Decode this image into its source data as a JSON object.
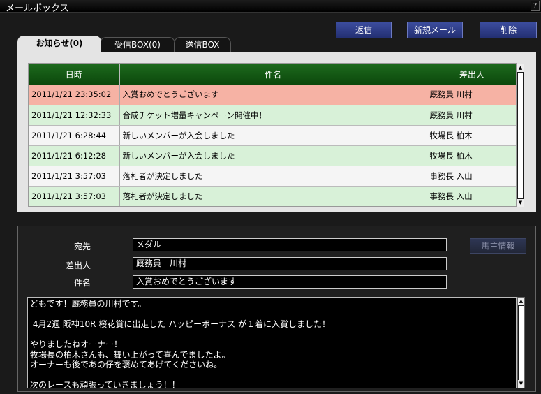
{
  "window": {
    "title": "メールボックス",
    "help": "?"
  },
  "toolbar": {
    "reply": "返信",
    "new_mail": "新規メール",
    "delete": "削除"
  },
  "tabs": [
    {
      "label": "お知らせ(0)",
      "active": true
    },
    {
      "label": "受信BOX(0)",
      "active": false
    },
    {
      "label": "送信BOX",
      "active": false
    }
  ],
  "list": {
    "headers": {
      "date": "日時",
      "subject": "件名",
      "sender": "差出人"
    },
    "rows": [
      {
        "date": "2011/1/21 23:35:02",
        "subject": "入賞おめでとうございます",
        "sender": "厩務員 川村",
        "style": "pink"
      },
      {
        "date": "2011/1/21 12:32:33",
        "subject": "合成チケット増量キャンペーン開催中！",
        "sender": "厩務員 川村",
        "style": "green"
      },
      {
        "date": "2011/1/21 6:28:44",
        "subject": "新しいメンバーが入会しました",
        "sender": "牧場長 柏木",
        "style": "white"
      },
      {
        "date": "2011/1/21 6:12:28",
        "subject": "新しいメンバーが入会しました",
        "sender": "牧場長 柏木",
        "style": "green"
      },
      {
        "date": "2011/1/21 3:57:03",
        "subject": "落札者が決定しました",
        "sender": "事務長 入山",
        "style": "white"
      },
      {
        "date": "2011/1/21 3:57:03",
        "subject": "落札者が決定しました",
        "sender": "事務長 入山",
        "style": "green"
      }
    ]
  },
  "detail": {
    "to_label": "宛先",
    "to": "メダル",
    "from_label": "差出人",
    "from": "厩務員　川村",
    "subject_label": "件名",
    "subject": "入賞おめでとうございます",
    "owner_button": "馬主情報",
    "body": "どもです！厩務員の川村です。\n\n 4月2週 阪神10R 桜花賞に出走した ハッピーボーナス が１着に入賞しました！\n\nやりましたねオーナー！\n牧場長の柏木さんも、舞い上がって喜んでましたよ。\nオーナーも後であの仔を褒めてあげてくださいね。\n\n次のレースも頑張っていきましょう！！"
  }
}
